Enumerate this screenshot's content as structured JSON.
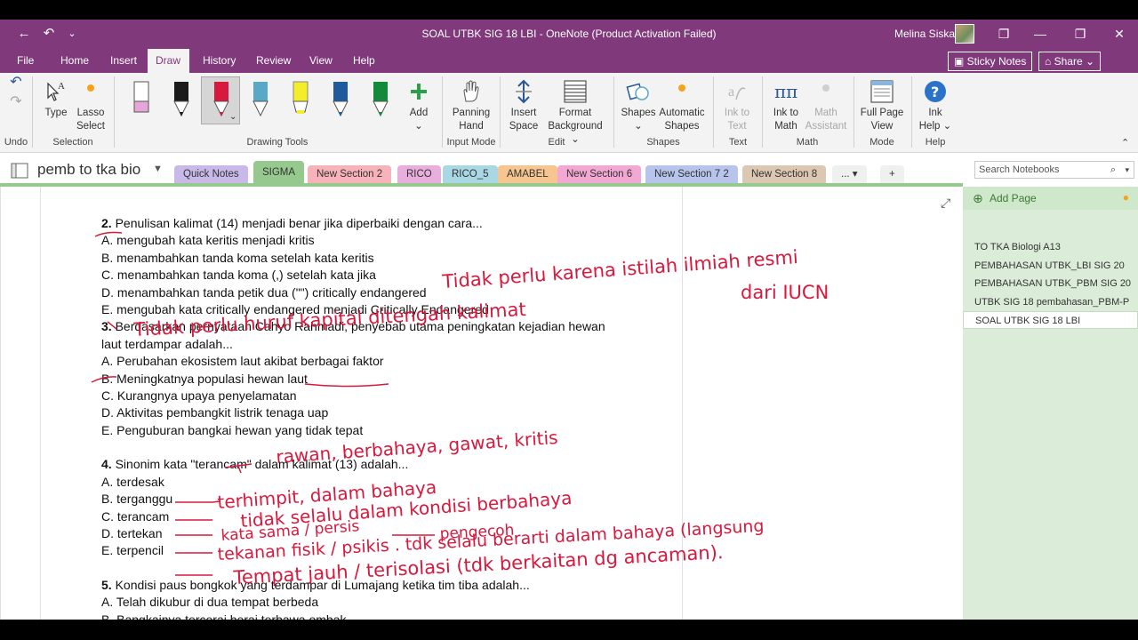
{
  "window": {
    "title": "SOAL UTBK SIG 18 LBI  -  OneNote (Product Activation Failed)",
    "user": "Melina Siska"
  },
  "menu": {
    "file": "File",
    "home": "Home",
    "insert": "Insert",
    "draw": "Draw",
    "history": "History",
    "review": "Review",
    "view": "View",
    "help": "Help",
    "sticky_notes": "Sticky Notes",
    "share": "Share"
  },
  "ribbon": {
    "type": "Type",
    "lasso_1": "Lasso",
    "lasso_2": "Select",
    "add": "Add",
    "panning_1": "Panning",
    "panning_2": "Hand",
    "insert_space_1": "Insert",
    "insert_space_2": "Space",
    "format_bg_1": "Format",
    "format_bg_2": "Background",
    "shapes": "Shapes",
    "auto_shapes_1": "Automatic",
    "auto_shapes_2": "Shapes",
    "ink_to_text_1": "Ink to",
    "ink_to_text_2": "Text",
    "ink_to_math_1": "Ink to",
    "ink_to_math_2": "Math",
    "math_assist_1": "Math",
    "math_assist_2": "Assistant",
    "full_page_1": "Full Page",
    "full_page_2": "View",
    "ink_help_1": "Ink",
    "ink_help_2": "Help",
    "groups": {
      "undo": "Undo",
      "selection": "Selection",
      "drawing_tools": "Drawing Tools",
      "input_mode": "Input Mode",
      "edit": "Edit",
      "shapes": "Shapes",
      "convert": "Text",
      "math": "Math",
      "mode": "Mode",
      "help": "Help"
    }
  },
  "notebook": {
    "name": "pemb to tka bio",
    "tabs": [
      {
        "label": "Quick Notes",
        "color": "#c9b9e9"
      },
      {
        "label": "SIGMA",
        "color": "#96c98e"
      },
      {
        "label": "New Section 2",
        "color": "#f7b2ba"
      },
      {
        "label": "RICO",
        "color": "#e9aedd"
      },
      {
        "label": "RICO_5",
        "color": "#a9d7e3"
      },
      {
        "label": "AMABEL",
        "color": "#f7c690"
      },
      {
        "label": "New Section 6",
        "color": "#f2a8d3"
      },
      {
        "label": "New Section 7 2",
        "color": "#b7c4ec"
      },
      {
        "label": "New Section 8",
        "color": "#dbc7b2"
      }
    ],
    "more": "...",
    "add_section": "+",
    "search_placeholder": "Search Notebooks"
  },
  "pages": {
    "add_page": "Add Page",
    "items": [
      "TO TKA Biologi A13",
      "PEMBAHASAN UTBK_LBI SIG 20",
      "PEMBAHASAN UTBK_PBM SIG 20",
      "UTBK SIG 18 pembahasan_PBM-P",
      "SOAL UTBK SIG 18 LBI"
    ]
  },
  "content": {
    "q2": {
      "num": "2.",
      "stem": "Penulisan kalimat (14) menjadi benar jika diperbaiki dengan cara...",
      "a": "A. mengubah kata keritis menjadi kritis",
      "b": "B. menambahkan tanda koma setelah kata keritis",
      "c": "C. menambahkan tanda koma (,) setelah kata jika",
      "d": "D. menambahkan tanda petik dua (\"\") critically endangered",
      "e": "E. mengubah kata critically endangered menjadi Critically Endangered"
    },
    "q3": {
      "num": "3.",
      "stem_1": "Berdasarkan pernyataan Cahyo Rahmadi, penyebab utama peningkatan kejadian hewan",
      "stem_2": "laut terdampar adalah...",
      "a": "A. Perubahan ekosistem laut akibat berbagai faktor",
      "b": "B. Meningkatnya populasi hewan laut",
      "c": "C. Kurangnya upaya penyelamatan",
      "d": "D. Aktivitas pembangkit listrik tenaga uap",
      "e": "E. Penguburan bangkai hewan yang tidak tepat"
    },
    "q4": {
      "num": "4.",
      "stem": "Sinonim kata \"terancam\" dalam kalimat (13) adalah...",
      "a": "A. terdesak",
      "b": "B. terganggu",
      "c": "C. terancam",
      "d": "D. tertekan",
      "e": "E. terpencil"
    },
    "q5": {
      "num": "5.",
      "stem": "Kondisi paus bongkok yang terdampar di Lumajang ketika tim tiba adalah...",
      "a": "A. Telah dikubur di dua tempat berbeda",
      "b": "B. Bangkainya tercerai berai terbawa ombak"
    }
  },
  "ink_notes": {
    "n1": "Tidak perlu karena istilah ilmiah resmi",
    "n2": "dari IUCN",
    "n3": "Tidak perlu huruf kapital ditengah kalimat",
    "n4": "rawan, berbahaya, gawat, kritis",
    "n5": "terhimpit, dalam bahaya",
    "n6": "tidak selalu dalam kondisi berbahaya",
    "n7": "kata sama / persis",
    "n8": "pengecoh",
    "n9": "tekanan fisik / psikis . tdk selalu berarti dalam bahaya (langsung",
    "n10": "Tempat jauh / terisolasi (tdk berkaitan dg ancaman)."
  },
  "colors": {
    "onenote_purple": "#80397b",
    "ink_red": "#d7193d",
    "section_green": "#96c98e"
  }
}
